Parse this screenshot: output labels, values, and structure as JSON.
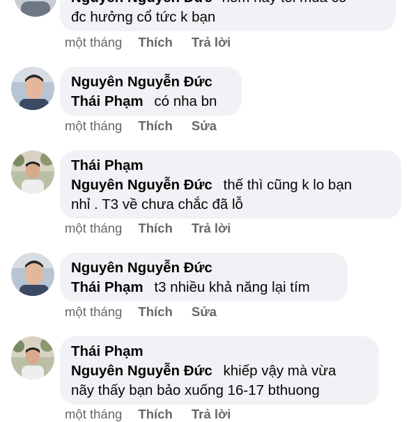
{
  "comments": [
    {
      "author": "Nguyên Nguyễn Đức",
      "mention": "",
      "text_line1": "hôm nay tôi mua có",
      "text_line2": "đc hưởng cổ tức k bạn",
      "time": "một tháng",
      "like": "Thích",
      "action": "Trả lời"
    },
    {
      "author": "Nguyên Nguyễn Đức",
      "mention": "Thái Phạm",
      "text": "có nha bn",
      "time": "một tháng",
      "like": "Thích",
      "action": "Sửa"
    },
    {
      "author": "Thái Phạm",
      "mention": "Nguyên Nguyễn Đức",
      "text_line1": "thế thì cũng k lo bạn",
      "text_line2": "nhỉ . T3 về chưa chắc đã lỗ",
      "time": "một tháng",
      "like": "Thích",
      "action": "Trả lời"
    },
    {
      "author": "Nguyên Nguyễn Đức",
      "mention": "Thái Phạm",
      "text": "t3 nhiều khả năng lại tím",
      "time": "một tháng",
      "like": "Thích",
      "action": "Sửa"
    },
    {
      "author": "Thái Phạm",
      "mention": "Nguyên Nguyễn Đức",
      "text_line1": "khiếp vậy mà vừa",
      "text_line2": "nãy thấy bạn bảo xuống 16-17 bthuong",
      "time": "một tháng",
      "like": "Thích",
      "action": "Trả lời"
    }
  ],
  "colors": {
    "bubble": "#f0f2f5",
    "meta_text": "#65676b",
    "name_text": "#050505"
  }
}
